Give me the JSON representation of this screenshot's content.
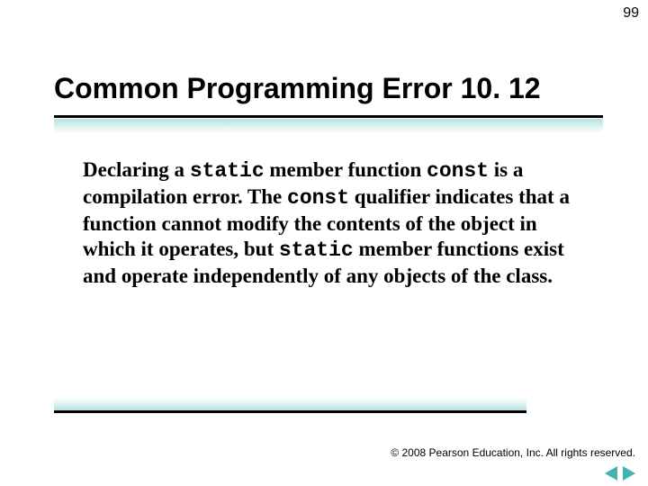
{
  "page_number": "99",
  "title": "Common Programming Error 10. 12",
  "body": {
    "t1": "Declaring a ",
    "k1": "static",
    "t2": " member function ",
    "k2": "const",
    "t3": " is a compilation error. The ",
    "k3": "const",
    "t4": " qualifier indicates that a function cannot modify the contents of the object in which it operates, but ",
    "k4": "static",
    "t5": " member functions exist and operate independently of any objects of the class."
  },
  "footer": "© 2008 Pearson Education, Inc. All rights reserved.",
  "colors": {
    "accent": "#46b2af",
    "gradient": "#b6e2e1"
  }
}
